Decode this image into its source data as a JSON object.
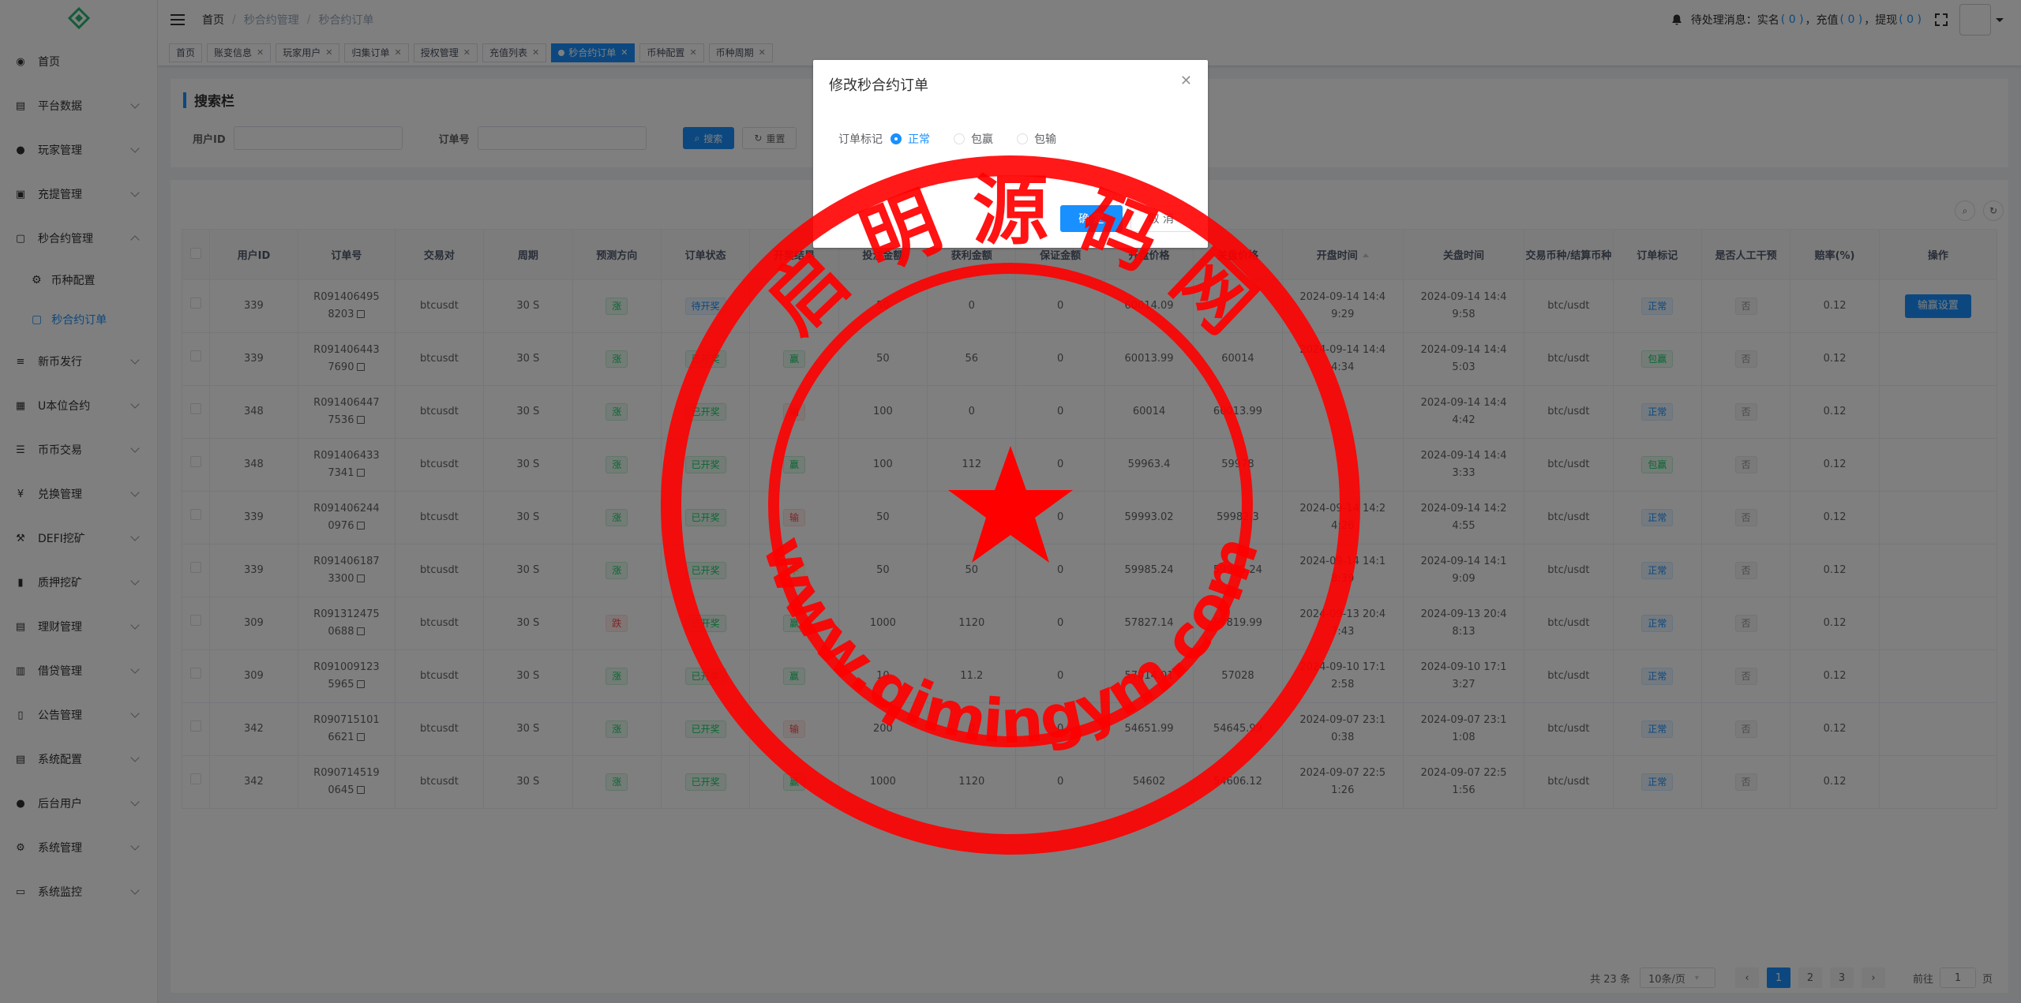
{
  "sidebar": {
    "items": [
      {
        "label": "首页",
        "icon": "dashboard-icon"
      },
      {
        "label": "平台数据",
        "icon": "data-icon"
      },
      {
        "label": "玩家管理",
        "icon": "user-icon"
      },
      {
        "label": "充提管理",
        "icon": "wallet-icon"
      },
      {
        "label": "秒合约管理",
        "icon": "contract-icon"
      },
      {
        "label": "新币发行",
        "icon": "coin-icon"
      },
      {
        "label": "U本位合约",
        "icon": "grid-icon"
      },
      {
        "label": "币币交易",
        "icon": "list-icon"
      },
      {
        "label": "兑换管理",
        "icon": "yen-icon"
      },
      {
        "label": "DEFI挖矿",
        "icon": "mining-icon"
      },
      {
        "label": "质押挖矿",
        "icon": "bar-chart-icon"
      },
      {
        "label": "理财管理",
        "icon": "finance-icon"
      },
      {
        "label": "借贷管理",
        "icon": "loan-icon"
      },
      {
        "label": "公告管理",
        "icon": "notice-icon"
      },
      {
        "label": "系统配置",
        "icon": "config-icon"
      },
      {
        "label": "后台用户",
        "icon": "admin-icon"
      },
      {
        "label": "系统管理",
        "icon": "gear-icon"
      },
      {
        "label": "系统监控",
        "icon": "monitor-icon"
      }
    ],
    "sub": {
      "coin_config": "币种配置",
      "orders": "秒合约订单"
    }
  },
  "header": {
    "breadcrumb": [
      "首页",
      "秒合约管理",
      "秒合约订单"
    ],
    "notice_prefix": "待处理消息：",
    "realname_label": "实名",
    "realname_count": "( 0 )",
    "recharge_label": "，充值",
    "recharge_count": "( 0 )",
    "withdraw_label": "，提现",
    "withdraw_count": "( 0 )"
  },
  "tags": [
    {
      "label": "首页",
      "closable": false
    },
    {
      "label": "账变信息",
      "closable": true
    },
    {
      "label": "玩家用户",
      "closable": true
    },
    {
      "label": "归集订单",
      "closable": true
    },
    {
      "label": "授权管理",
      "closable": true
    },
    {
      "label": "充值列表",
      "closable": true
    },
    {
      "label": "秒合约订单",
      "closable": true,
      "active": true
    },
    {
      "label": "币种配置",
      "closable": true
    },
    {
      "label": "币种周期",
      "closable": true
    }
  ],
  "search": {
    "title": "搜索栏",
    "user_id_label": "用户ID",
    "order_no_label": "订单号",
    "search_btn": "搜索",
    "reset_btn": "重置"
  },
  "table": {
    "columns": [
      "用户ID",
      "订单号",
      "交易对",
      "周期",
      "预测方向",
      "订单状态",
      "开奖结果",
      "投注金额",
      "获利金额",
      "保证金额",
      "开盘价格",
      "关盘价格",
      "开盘时间",
      "关盘时间",
      "交易币种/结算币种",
      "订单标记",
      "是否人工干预",
      "赔率(%)",
      "操作"
    ],
    "rows": [
      {
        "uid": "339",
        "order": "R0914064958203",
        "pair": "btcusdt",
        "period": "30 S",
        "dir": "涨",
        "status": "待开奖",
        "result": "",
        "bet": "50",
        "profit": "0",
        "margin": "0",
        "open": "60014.09",
        "close": "",
        "open_time": "2024-09-14 14:49:29",
        "close_time": "2024-09-14 14:49:58",
        "coins": "btc/usdt",
        "mark": "正常",
        "manual": "否",
        "rate": "0.12",
        "op": "输赢设置"
      },
      {
        "uid": "339",
        "order": "R0914064437690",
        "pair": "btcusdt",
        "period": "30 S",
        "dir": "涨",
        "status": "已开奖",
        "result": "赢",
        "bet": "50",
        "profit": "56",
        "margin": "0",
        "open": "60013.99",
        "close": "60014",
        "open_time": "2024-09-14 14:44:34",
        "close_time": "2024-09-14 14:45:03",
        "coins": "btc/usdt",
        "mark": "包赢",
        "manual": "否",
        "rate": "0.12",
        "op": ""
      },
      {
        "uid": "348",
        "order": "R0914064477536",
        "pair": "btcusdt",
        "period": "30 S",
        "dir": "涨",
        "status": "已开奖",
        "result": "输",
        "bet": "100",
        "profit": "0",
        "margin": "0",
        "open": "60014",
        "close": "60013.99",
        "open_time": "",
        "close_time": "2024-09-14 14:44:42",
        "coins": "btc/usdt",
        "mark": "正常",
        "manual": "否",
        "rate": "0.12",
        "op": ""
      },
      {
        "uid": "348",
        "order": "R0914064337341",
        "pair": "btcusdt",
        "period": "30 S",
        "dir": "涨",
        "status": "已开奖",
        "result": "赢",
        "bet": "100",
        "profit": "112",
        "margin": "0",
        "open": "59963.4",
        "close": "59978",
        "open_time": "",
        "close_time": "2024-09-14 14:43:33",
        "coins": "btc/usdt",
        "mark": "包赢",
        "manual": "否",
        "rate": "0.12",
        "op": ""
      },
      {
        "uid": "339",
        "order": "R0914062440976",
        "pair": "btcusdt",
        "period": "30 S",
        "dir": "涨",
        "status": "已开奖",
        "result": "输",
        "bet": "50",
        "profit": "",
        "margin": "0",
        "open": "59993.02",
        "close": "59982.3",
        "open_time": "2024-09-14 14:24:26",
        "close_time": "2024-09-14 14:24:55",
        "coins": "btc/usdt",
        "mark": "正常",
        "manual": "否",
        "rate": "0.12",
        "op": ""
      },
      {
        "uid": "339",
        "order": "R0914061873300",
        "pair": "btcusdt",
        "period": "30 S",
        "dir": "涨",
        "status": "已开奖",
        "result": "平",
        "bet": "50",
        "profit": "50",
        "margin": "0",
        "open": "59985.24",
        "close": "59985.24",
        "open_time": "2024-09-14 14:18:39",
        "close_time": "2024-09-14 14:19:09",
        "coins": "btc/usdt",
        "mark": "正常",
        "manual": "否",
        "rate": "0.12",
        "op": ""
      },
      {
        "uid": "309",
        "order": "R0913124750688",
        "pair": "btcusdt",
        "period": "30 S",
        "dir": "跌",
        "status": "已开奖",
        "result": "赢",
        "bet": "1000",
        "profit": "1120",
        "margin": "0",
        "open": "57827.14",
        "close": "57819.99",
        "open_time": "2024-09-13 20:47:43",
        "close_time": "2024-09-13 20:48:13",
        "coins": "btc/usdt",
        "mark": "正常",
        "manual": "否",
        "rate": "0.12",
        "op": ""
      },
      {
        "uid": "309",
        "order": "R0910091235965",
        "pair": "btcusdt",
        "period": "30 S",
        "dir": "涨",
        "status": "已开奖",
        "result": "赢",
        "bet": "10",
        "profit": "11.2",
        "margin": "0",
        "open": "57014.01",
        "close": "57028",
        "open_time": "2024-09-10 17:12:58",
        "close_time": "2024-09-10 17:13:27",
        "coins": "btc/usdt",
        "mark": "正常",
        "manual": "否",
        "rate": "0.12",
        "op": ""
      },
      {
        "uid": "342",
        "order": "R0907151016621",
        "pair": "btcusdt",
        "period": "30 S",
        "dir": "涨",
        "status": "已开奖",
        "result": "输",
        "bet": "200",
        "profit": "0",
        "margin": "0",
        "open": "54651.99",
        "close": "54645.99",
        "open_time": "2024-09-07 23:10:38",
        "close_time": "2024-09-07 23:11:08",
        "coins": "btc/usdt",
        "mark": "正常",
        "manual": "否",
        "rate": "0.12",
        "op": ""
      },
      {
        "uid": "342",
        "order": "R0907145190645",
        "pair": "btcusdt",
        "period": "30 S",
        "dir": "涨",
        "status": "已开奖",
        "result": "赢",
        "bet": "1000",
        "profit": "1120",
        "margin": "0",
        "open": "54602",
        "close": "54606.12",
        "open_time": "2024-09-07 22:51:26",
        "close_time": "2024-09-07 22:51:56",
        "coins": "btc/usdt",
        "mark": "正常",
        "manual": "否",
        "rate": "0.12",
        "op": ""
      }
    ]
  },
  "pagination": {
    "total": "共 23 条",
    "page_size": "10条/页",
    "pages": [
      "1",
      "2",
      "3"
    ],
    "current": "1",
    "goto_label": "前往",
    "goto_value": "1",
    "page_suffix": "页"
  },
  "dialog": {
    "title": "修改秒合约订单",
    "field_label": "订单标记",
    "options": [
      "正常",
      "包赢",
      "包输"
    ],
    "selected": "正常",
    "confirm": "确 定",
    "cancel": "取 消"
  },
  "watermark": {
    "top_text": "启 明 源 码 网",
    "bottom_text": "www.qimingym.com",
    "color": "#ff0000"
  },
  "colors": {
    "accent": "#1890ff",
    "sidebar_bg": "#ffffff"
  }
}
